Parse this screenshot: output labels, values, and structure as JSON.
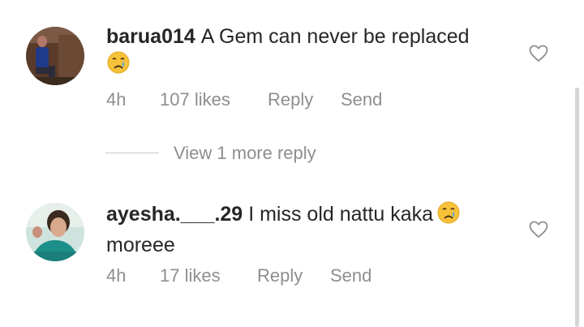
{
  "comments": [
    {
      "username": "barua014",
      "text": "A Gem can never be replaced",
      "emoji": "crying-face-emoji",
      "time": "4h",
      "likes": "107 likes",
      "reply_label": "Reply",
      "send_label": "Send"
    },
    {
      "username": "ayesha.___.29",
      "text": "I miss old nattu kaka",
      "emoji": "crying-face-emoji",
      "text_cont": "moreee",
      "time": "4h",
      "likes": "17 likes",
      "reply_label": "Reply",
      "send_label": "Send"
    }
  ],
  "view_replies": {
    "label": "View 1 more reply"
  },
  "colors": {
    "text": "#262626",
    "secondary": "#8e8e8e",
    "divider": "#c7c7c7"
  }
}
